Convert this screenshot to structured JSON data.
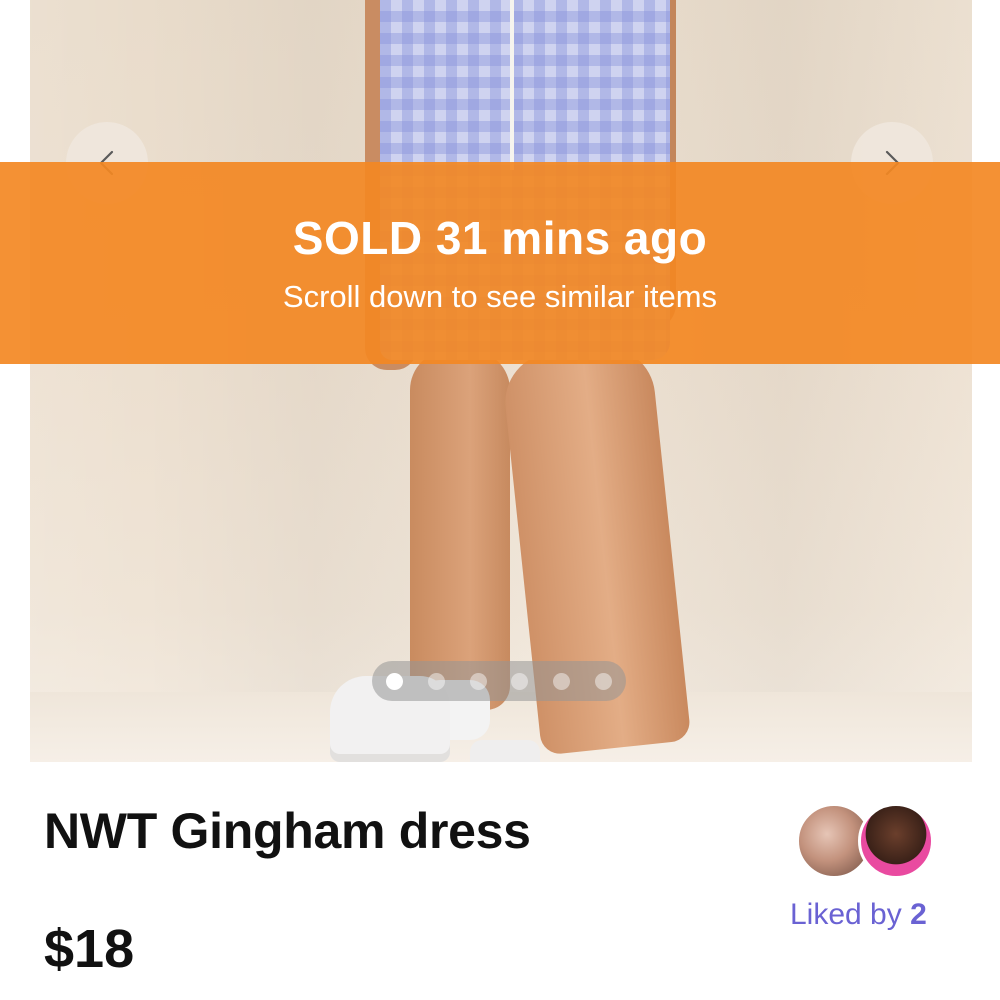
{
  "banner": {
    "title": "SOLD 31 mins ago",
    "subtitle": "Scroll down to see similar items",
    "color": "#f38823"
  },
  "carousel": {
    "total_images": 6,
    "active_index": 0,
    "prev_icon": "chevron-left-icon",
    "next_icon": "chevron-right-icon"
  },
  "item": {
    "title": "NWT Gingham dress",
    "price": "$18"
  },
  "likes": {
    "label": "Liked by",
    "count": "2",
    "color": "#6a62d3"
  }
}
